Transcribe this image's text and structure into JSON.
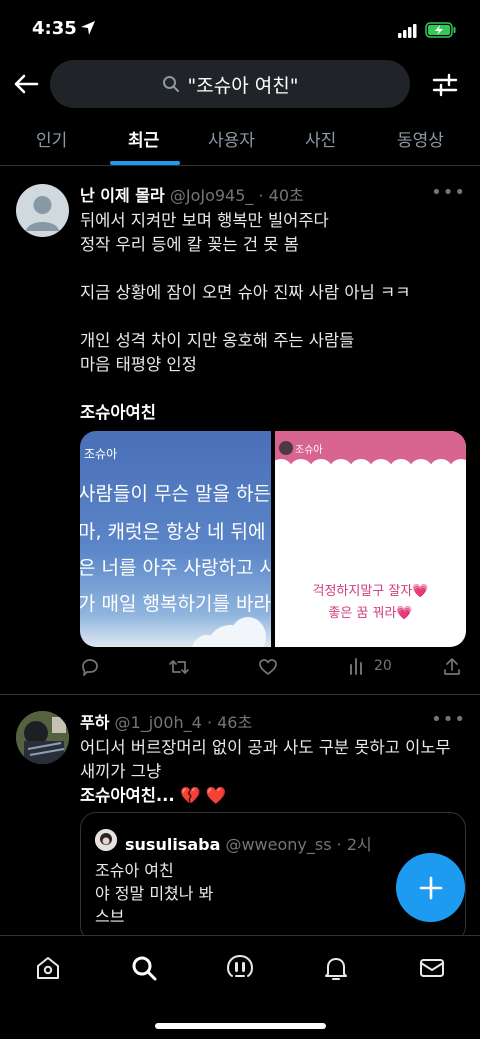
{
  "status": {
    "time": "4:35"
  },
  "search": {
    "query": "\"조슈아 여친\""
  },
  "tabs": [
    {
      "label": "인기"
    },
    {
      "label": "최근"
    },
    {
      "label": "사용자"
    },
    {
      "label": "사진"
    },
    {
      "label": "동영상"
    }
  ],
  "tweets": [
    {
      "name": "난 이제 몰라",
      "meta": "@JoJo945_ · 40초",
      "text_lines": [
        "뒤에서 지켜만 보며 행복만 빌어주다",
        "정작 우리 등에 칼 꽂는 건 못 봄",
        "",
        "지금 상황에 잠이 오면 슈아 진짜 사람 아님 ㅋㅋ",
        "",
        "개인 성격 차이 지만 옹호해 주는 사람들",
        "마음 태평양 인정",
        ""
      ],
      "bold_line": "조슈아여친",
      "media_left": {
        "label": "조슈아",
        "lines": [
          "사람들이 무슨 말을 하든",
          "마, 캐럿은 항상 네 뒤에",
          "은 너를 아주 사랑하고 사",
          "가 매일 행복하기를 바라"
        ]
      },
      "media_right": {
        "label": "조슈아",
        "lines": [
          "걱정하지말구 잘자💗",
          "좋은 꿈 꿔라💗"
        ]
      },
      "views": "20"
    },
    {
      "name": "푸하",
      "meta": "@1_j00h_4 · 46초",
      "text_lines": [
        "어디서 버르장머리 없이 공과 사도 구분 못하고 이노무",
        "새끼가 그냥"
      ],
      "bold_line": "조슈아여친...",
      "emoji": "💔 ❤️",
      "quote": {
        "name": "susulisaba",
        "meta": "@wweony_ss · 2시",
        "lines": [
          "조슈아 여친",
          "야 정말 미쳤나 봐",
          "스브"
        ]
      }
    }
  ]
}
